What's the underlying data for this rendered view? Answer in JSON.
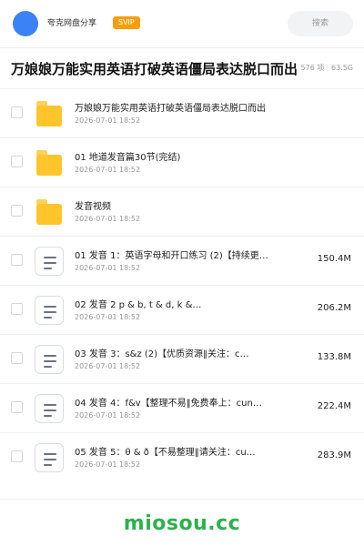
{
  "header": {
    "site_name": "夸克网盘分享",
    "badge": "SVIP",
    "search_placeholder": "搜索",
    "avatar_color": "#3b82f6",
    "badge_color": "#f59e0b"
  },
  "page": {
    "title": "万娘娘万能实用英语打破英语僵局表达脱口而出",
    "meta": "576 项 · 63.5G"
  },
  "items": [
    {
      "type": "folder",
      "name": "万娘娘万能实用英语打破英语僵局表达脱口而出",
      "date": "2026-07-01 18:52",
      "size": "",
      "icon": "folder-icon"
    },
    {
      "type": "folder",
      "name": "01 地道发音篇30节(完结)",
      "date": "2026-07-01 18:52",
      "size": "",
      "icon": "folder-icon"
    },
    {
      "type": "folder",
      "name": "发音视频",
      "date": "2026-07-01 18:52",
      "size": "",
      "icon": "folder-icon"
    },
    {
      "type": "file",
      "name": "01 发音 1：英语字母和开口练习 (2)【持续更…",
      "date": "2026-07-01 18:52",
      "size": "150.4M",
      "icon": "document-icon"
    },
    {
      "type": "file",
      "name": "02 发音 2 p & b, t & d, k &…",
      "date": "2026-07-01 18:52",
      "size": "206.2M",
      "icon": "document-icon"
    },
    {
      "type": "file",
      "name": "03 发音 3：s&z (2)【优质资源‖关注：c…",
      "date": "2026-07-01 18:52",
      "size": "133.8M",
      "icon": "document-icon"
    },
    {
      "type": "file",
      "name": "04 发音 4：f&v【整理不易‖免费奉上：cun…",
      "date": "2026-07-01 18:52",
      "size": "222.4M",
      "icon": "document-icon"
    },
    {
      "type": "file",
      "name": "05 发音 5：θ & ð【不易整理‖请关注：cu…",
      "date": "2026-07-01 18:52",
      "size": "283.9M",
      "icon": "document-icon"
    }
  ],
  "watermark": "miosou.cc",
  "colors": {
    "folder": "#ffc52a",
    "watermark": "#2bb24c"
  }
}
